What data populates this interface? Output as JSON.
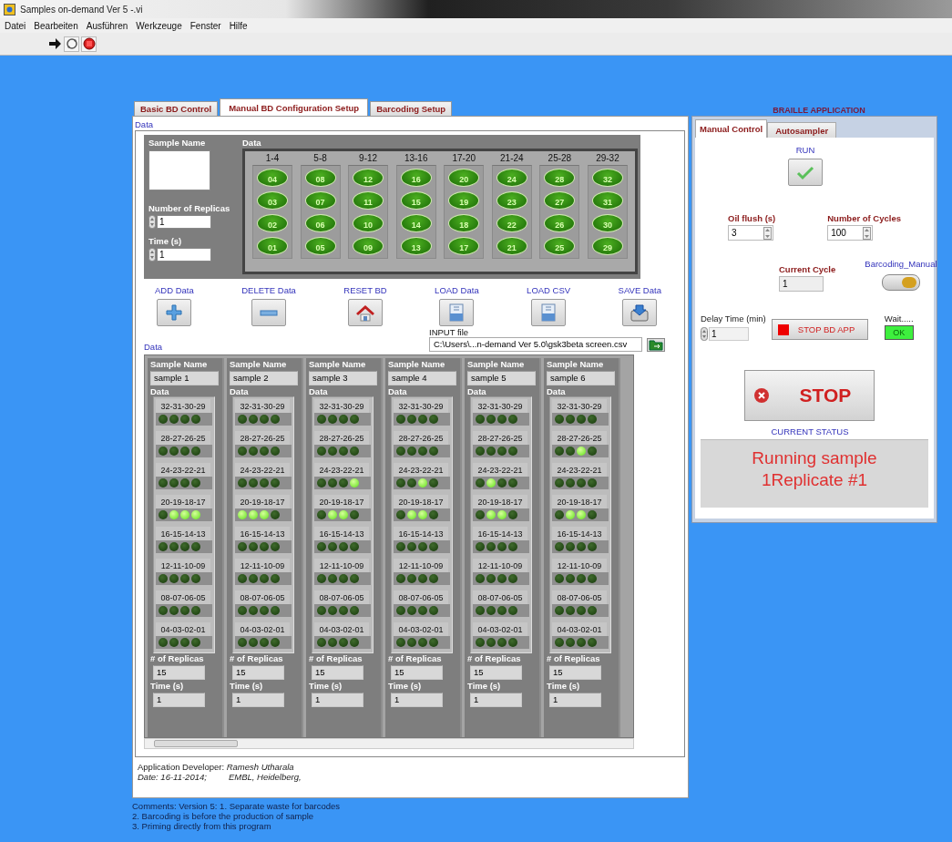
{
  "window": {
    "title": "Samples on-demand Ver 5 -.vi"
  },
  "menu": [
    "Datei",
    "Bearbeiten",
    "Ausführen",
    "Werkzeuge",
    "Fenster",
    "Hilfe"
  ],
  "toolbar": [
    {
      "kind": "run"
    },
    {
      "kind": "run_continuously"
    },
    {
      "kind": "abort"
    }
  ],
  "main_tabs": [
    {
      "label": "Basic BD Control",
      "selected": false
    },
    {
      "label": "Manual BD Configuration Setup",
      "selected": true
    },
    {
      "label": "Barcoding Setup",
      "selected": false
    }
  ],
  "config": {
    "label": "Data",
    "sample_name": {
      "label": "Sample Name"
    },
    "replicas": {
      "label": "Number of Replicas",
      "value": "1"
    },
    "time": {
      "label": "Time (s)",
      "value": "1"
    },
    "bd": {
      "label": "Data",
      "columns": [
        {
          "label": "1-4",
          "wells": [
            "04",
            "03",
            "02",
            "01"
          ]
        },
        {
          "label": "5-8",
          "wells": [
            "08",
            "07",
            "06",
            "05"
          ]
        },
        {
          "label": "9-12",
          "wells": [
            "12",
            "11",
            "10",
            "09"
          ]
        },
        {
          "label": "13-16",
          "wells": [
            "16",
            "15",
            "14",
            "13"
          ]
        },
        {
          "label": "17-20",
          "wells": [
            "20",
            "19",
            "18",
            "17"
          ]
        },
        {
          "label": "21-24",
          "wells": [
            "24",
            "23",
            "22",
            "21"
          ]
        },
        {
          "label": "25-28",
          "wells": [
            "28",
            "27",
            "26",
            "25"
          ]
        },
        {
          "label": "29-32",
          "wells": [
            "32",
            "31",
            "30",
            "29"
          ]
        }
      ]
    }
  },
  "actions": [
    {
      "label": "ADD Data",
      "kind": "add"
    },
    {
      "label": "DELETE Data",
      "kind": "delete"
    },
    {
      "label": "RESET BD",
      "kind": "reset"
    },
    {
      "label": "LOAD Data",
      "kind": "load"
    },
    {
      "label": "LOAD CSV",
      "kind": "load"
    },
    {
      "label": "SAVE Data",
      "kind": "save"
    }
  ],
  "input_file": {
    "label": "INPUT file",
    "value": "C:\\Users\\...n-demand Ver 5.0\\gsk3beta screen.csv"
  },
  "samples": {
    "label": "Data",
    "items": [
      {
        "name_label": "Sample Name",
        "name": "sample 1",
        "data_label": "Data",
        "groups": [
          {
            "label": "32-31-30-29",
            "leds": [
              false,
              false,
              false,
              false
            ]
          },
          {
            "label": "28-27-26-25",
            "leds": [
              false,
              false,
              false,
              false
            ]
          },
          {
            "label": "24-23-22-21",
            "leds": [
              false,
              false,
              false,
              false
            ]
          },
          {
            "label": "20-19-18-17",
            "leds": [
              false,
              true,
              true,
              true
            ]
          },
          {
            "label": "16-15-14-13",
            "leds": [
              false,
              false,
              false,
              false
            ]
          },
          {
            "label": "12-11-10-09",
            "leds": [
              false,
              false,
              false,
              false
            ]
          },
          {
            "label": "08-07-06-05",
            "leds": [
              false,
              false,
              false,
              false
            ]
          },
          {
            "label": "04-03-02-01",
            "leds": [
              false,
              false,
              false,
              false
            ]
          }
        ],
        "replicas_label": "# of Replicas",
        "replicas": "15",
        "time_label": "Time (s)",
        "time": "1"
      },
      {
        "name_label": "Sample Name",
        "name": "sample 2",
        "data_label": "Data",
        "groups": [
          {
            "label": "32-31-30-29",
            "leds": [
              false,
              false,
              false,
              false
            ]
          },
          {
            "label": "28-27-26-25",
            "leds": [
              false,
              false,
              false,
              false
            ]
          },
          {
            "label": "24-23-22-21",
            "leds": [
              false,
              false,
              false,
              false
            ]
          },
          {
            "label": "20-19-18-17",
            "leds": [
              true,
              true,
              true,
              false
            ]
          },
          {
            "label": "16-15-14-13",
            "leds": [
              false,
              false,
              false,
              false
            ]
          },
          {
            "label": "12-11-10-09",
            "leds": [
              false,
              false,
              false,
              false
            ]
          },
          {
            "label": "08-07-06-05",
            "leds": [
              false,
              false,
              false,
              false
            ]
          },
          {
            "label": "04-03-02-01",
            "leds": [
              false,
              false,
              false,
              false
            ]
          }
        ],
        "replicas_label": "# of Replicas",
        "replicas": "15",
        "time_label": "Time (s)",
        "time": "1"
      },
      {
        "name_label": "Sample Name",
        "name": "sample 3",
        "data_label": "Data",
        "groups": [
          {
            "label": "32-31-30-29",
            "leds": [
              false,
              false,
              false,
              false
            ]
          },
          {
            "label": "28-27-26-25",
            "leds": [
              false,
              false,
              false,
              false
            ]
          },
          {
            "label": "24-23-22-21",
            "leds": [
              false,
              false,
              false,
              true
            ]
          },
          {
            "label": "20-19-18-17",
            "leds": [
              false,
              true,
              true,
              false
            ]
          },
          {
            "label": "16-15-14-13",
            "leds": [
              false,
              false,
              false,
              false
            ]
          },
          {
            "label": "12-11-10-09",
            "leds": [
              false,
              false,
              false,
              false
            ]
          },
          {
            "label": "08-07-06-05",
            "leds": [
              false,
              false,
              false,
              false
            ]
          },
          {
            "label": "04-03-02-01",
            "leds": [
              false,
              false,
              false,
              false
            ]
          }
        ],
        "replicas_label": "# of Replicas",
        "replicas": "15",
        "time_label": "Time (s)",
        "time": "1"
      },
      {
        "name_label": "Sample Name",
        "name": "sample 4",
        "data_label": "Data",
        "groups": [
          {
            "label": "32-31-30-29",
            "leds": [
              false,
              false,
              false,
              false
            ]
          },
          {
            "label": "28-27-26-25",
            "leds": [
              false,
              false,
              false,
              false
            ]
          },
          {
            "label": "24-23-22-21",
            "leds": [
              false,
              false,
              true,
              false
            ]
          },
          {
            "label": "20-19-18-17",
            "leds": [
              false,
              true,
              true,
              false
            ]
          },
          {
            "label": "16-15-14-13",
            "leds": [
              false,
              false,
              false,
              false
            ]
          },
          {
            "label": "12-11-10-09",
            "leds": [
              false,
              false,
              false,
              false
            ]
          },
          {
            "label": "08-07-06-05",
            "leds": [
              false,
              false,
              false,
              false
            ]
          },
          {
            "label": "04-03-02-01",
            "leds": [
              false,
              false,
              false,
              false
            ]
          }
        ],
        "replicas_label": "# of Replicas",
        "replicas": "15",
        "time_label": "Time (s)",
        "time": "1"
      },
      {
        "name_label": "Sample Name",
        "name": "sample 5",
        "data_label": "Data",
        "groups": [
          {
            "label": "32-31-30-29",
            "leds": [
              false,
              false,
              false,
              false
            ]
          },
          {
            "label": "28-27-26-25",
            "leds": [
              false,
              false,
              false,
              false
            ]
          },
          {
            "label": "24-23-22-21",
            "leds": [
              false,
              true,
              false,
              false
            ]
          },
          {
            "label": "20-19-18-17",
            "leds": [
              false,
              true,
              true,
              false
            ]
          },
          {
            "label": "16-15-14-13",
            "leds": [
              false,
              false,
              false,
              false
            ]
          },
          {
            "label": "12-11-10-09",
            "leds": [
              false,
              false,
              false,
              false
            ]
          },
          {
            "label": "08-07-06-05",
            "leds": [
              false,
              false,
              false,
              false
            ]
          },
          {
            "label": "04-03-02-01",
            "leds": [
              false,
              false,
              false,
              false
            ]
          }
        ],
        "replicas_label": "# of Replicas",
        "replicas": "15",
        "time_label": "Time (s)",
        "time": "1"
      },
      {
        "name_label": "Sample Name",
        "name": "sample 6",
        "data_label": "Data",
        "groups": [
          {
            "label": "32-31-30-29",
            "leds": [
              false,
              false,
              false,
              false
            ]
          },
          {
            "label": "28-27-26-25",
            "leds": [
              false,
              false,
              true,
              false
            ]
          },
          {
            "label": "24-23-22-21",
            "leds": [
              false,
              false,
              false,
              false
            ]
          },
          {
            "label": "20-19-18-17",
            "leds": [
              false,
              true,
              true,
              false
            ]
          },
          {
            "label": "16-15-14-13",
            "leds": [
              false,
              false,
              false,
              false
            ]
          },
          {
            "label": "12-11-10-09",
            "leds": [
              false,
              false,
              false,
              false
            ]
          },
          {
            "label": "08-07-06-05",
            "leds": [
              false,
              false,
              false,
              false
            ]
          },
          {
            "label": "04-03-02-01",
            "leds": [
              false,
              false,
              false,
              false
            ]
          }
        ],
        "replicas_label": "# of Replicas",
        "replicas": "15",
        "time_label": "Time (s)",
        "time": "1"
      }
    ]
  },
  "footer": {
    "developer": "Application Developer: *Ramesh Utharala*",
    "date": "Date: 16-11-2014;",
    "place": "EMBL, Heidelberg,"
  },
  "braille": {
    "title": "BRAILLE APPLICATION",
    "tabs": [
      {
        "label": "Manual Control",
        "selected": true
      },
      {
        "label": "Autosampler",
        "selected": false
      }
    ],
    "run_label": "RUN",
    "oil_flush": {
      "label": "Oil flush (s)",
      "value": "3"
    },
    "cycles": {
      "label": "Number of Cycles",
      "value": "100"
    },
    "current_cycle": {
      "label": "Current Cycle",
      "value": "1"
    },
    "barcoding": {
      "label": "Barcoding_Manual",
      "on": true
    },
    "delay": {
      "label": "Delay Time (min)",
      "value": "1"
    },
    "stop_bd": "STOP BD APP",
    "wait": {
      "label": "Wait.....",
      "text": "OK",
      "on": true
    },
    "stop": "STOP",
    "status": {
      "label": "CURRENT STATUS",
      "value": "Running sample\n1Replicate #1"
    }
  },
  "comments": [
    "Comments: Version 5: 1. Separate waste for barcodes",
    "2. Barcoding is before the production of sample",
    "3. Priming directly from this program"
  ]
}
